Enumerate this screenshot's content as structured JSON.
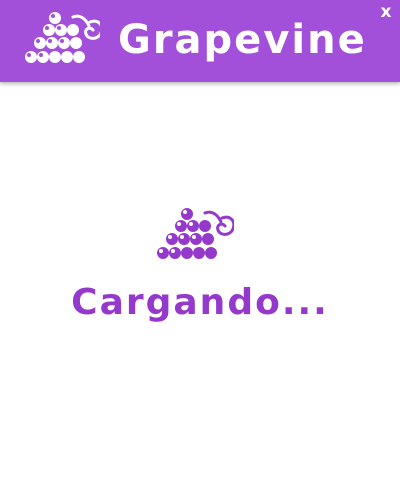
{
  "app": {
    "title": "Grapevine",
    "close_label": "x"
  },
  "loading": {
    "text": "Cargando..."
  },
  "icons": {
    "header_logo": "grape-cluster-icon",
    "loading_logo": "grape-cluster-icon"
  },
  "colors": {
    "header_background": "#a24fda",
    "accent": "#9439cc",
    "page_background": "#ffffff",
    "header_text": "#ffffff"
  }
}
